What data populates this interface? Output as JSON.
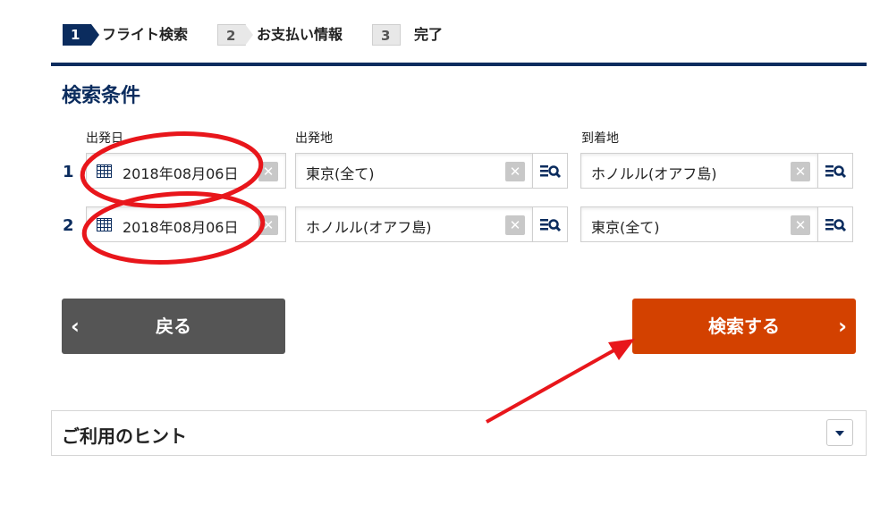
{
  "steps": [
    {
      "num": "1",
      "label": "フライト検索",
      "state": "active"
    },
    {
      "num": "2",
      "label": "お支払い情報",
      "state": "todo"
    },
    {
      "num": "3",
      "label": "完了",
      "state": "todo"
    }
  ],
  "section_title": "検索条件",
  "columns": {
    "date": "出発日",
    "origin": "出発地",
    "destination": "到着地"
  },
  "rows": [
    {
      "num": "1",
      "date": "2018年08月06日",
      "origin": "東京(全て)",
      "destination": "ホノルル(オアフ島)"
    },
    {
      "num": "2",
      "date": "2018年08月06日",
      "origin": "ホノルル(オアフ島)",
      "destination": "東京(全て)"
    }
  ],
  "icons": {
    "clear": "clear-icon",
    "lookup": "search-list-icon",
    "calendar": "calendar-icon"
  },
  "buttons": {
    "back": "戻る",
    "search": "検索する"
  },
  "hints": {
    "title": "ご利用のヒント"
  },
  "colors": {
    "brand_navy": "#0b2c5e",
    "search_orange": "#d34100",
    "back_gray": "#555555",
    "annotation_red": "#e8161b"
  }
}
